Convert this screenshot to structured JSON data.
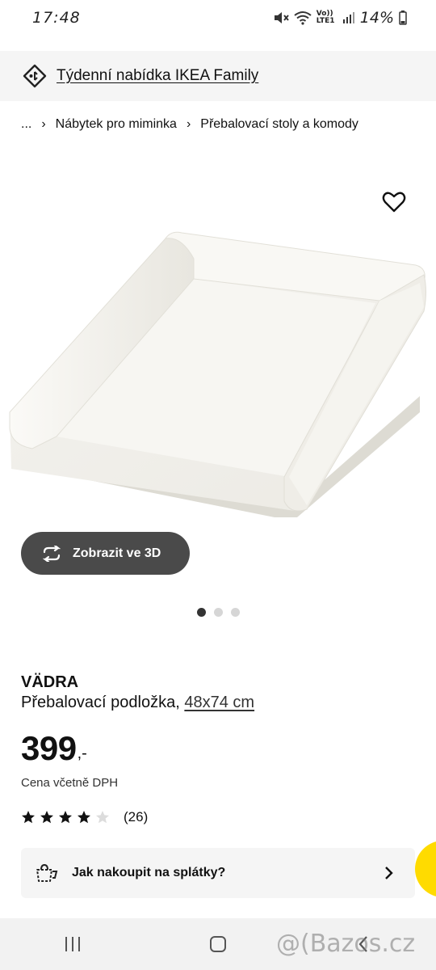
{
  "status_bar": {
    "time": "17:48",
    "battery": "14%",
    "network": "Vo)) LTE1",
    "icons": [
      "mute-vibrate-icon",
      "wifi-icon",
      "signal-icon",
      "battery-icon"
    ]
  },
  "family_banner": {
    "label": "Týdenní nabídka IKEA Family",
    "icon": "price-tag-icon"
  },
  "breadcrumb": {
    "items": [
      "...",
      "Nábytek pro miminka",
      "Přebalovací stoly a komody"
    ]
  },
  "gallery": {
    "view_3d_label": "Zobrazit ve 3D",
    "current_index": 1,
    "total": 3
  },
  "product": {
    "name": "VÄDRA",
    "description": "Přebalovací podložka,",
    "size": "48x74 cm",
    "price": "399",
    "price_suffix": ",-",
    "price_note": "Cena včetně DPH",
    "rating": 4,
    "rating_max": 5,
    "review_count": "(26)"
  },
  "installments": {
    "label": "Jak nakoupit na splátky?"
  },
  "watermark": "@(Bazos.cz",
  "colors": {
    "accent_yellow": "#ffdb00",
    "button_dark": "#4a4a4a",
    "banner_bg": "#f5f5f5"
  }
}
